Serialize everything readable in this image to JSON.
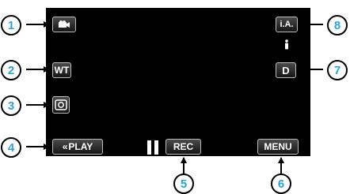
{
  "buttons": {
    "mode_icon": "video-camera-icon",
    "wt_label": "WT",
    "snapshot_icon": "camera-icon",
    "play_label": "PLAY",
    "play_icon": "double-chevron-left-icon",
    "pause_icon": "pause-icon",
    "rec_label": "REC",
    "menu_label": "MENU",
    "ia_label": "i.A.",
    "d_label": "D",
    "status_icon": "person-icon"
  },
  "callouts": [
    "1",
    "2",
    "3",
    "4",
    "5",
    "6",
    "7",
    "8"
  ],
  "colors": {
    "callout_number": "#2fa0d8",
    "screen": "#000000",
    "button_border": "#bdbdbd"
  }
}
